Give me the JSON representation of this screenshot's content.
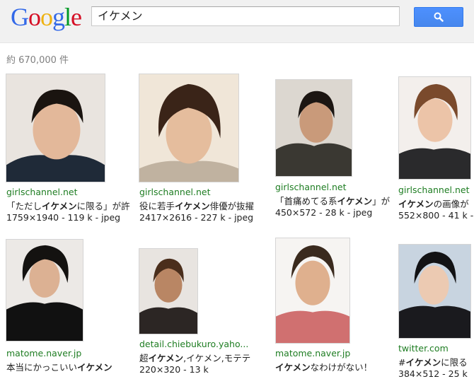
{
  "logo": {
    "letters": [
      "G",
      "o",
      "o",
      "g",
      "l",
      "e"
    ],
    "colors": [
      "#3369e8",
      "#d50f25",
      "#eeb211",
      "#3369e8",
      "#009925",
      "#d50f25"
    ]
  },
  "search": {
    "query": "イケメン",
    "button_icon": "search-icon"
  },
  "results_stats": "約 670,000 件",
  "results": [
    {
      "site": "girlschannel.net",
      "title_pre": "「ただし",
      "title_bold": "イケメン",
      "title_post": "に限る」が許",
      "meta": "1759×1940 - 119 k - jpeg"
    },
    {
      "site": "girlschannel.net",
      "title_pre": "役に若手",
      "title_bold": "イケメン",
      "title_post": "俳優が抜擢",
      "meta": "2417×2616 - 227 k - jpeg"
    },
    {
      "site": "girlschannel.net",
      "title_pre": "「首痛めてる系",
      "title_bold": "イケメン",
      "title_post": "」が",
      "meta": "450×572 - 28 k - jpeg"
    },
    {
      "site": "girlschannel.net",
      "title_pre": "",
      "title_bold": "イケメン",
      "title_post": "の画像が",
      "meta": "552×800 - 41 k -"
    },
    {
      "site": "matome.naver.jp",
      "title_pre": "本当にかっこいい",
      "title_bold": "イケメン",
      "title_post": "",
      "meta": ""
    },
    {
      "site": "detail.chiebukuro.yaho...",
      "title_pre": "超",
      "title_bold": "イケメン",
      "title_post": ",イケメン,モテテ",
      "meta": "220×320 - 13 k"
    },
    {
      "site": "matome.naver.jp",
      "title_pre": "",
      "title_bold": "イケメン",
      "title_post": "なわけがない！",
      "meta": ""
    },
    {
      "site": "twitter.com",
      "title_pre": "#",
      "title_bold": "イケメン",
      "title_post": "に限る",
      "meta": "384×512 - 25 k"
    }
  ]
}
